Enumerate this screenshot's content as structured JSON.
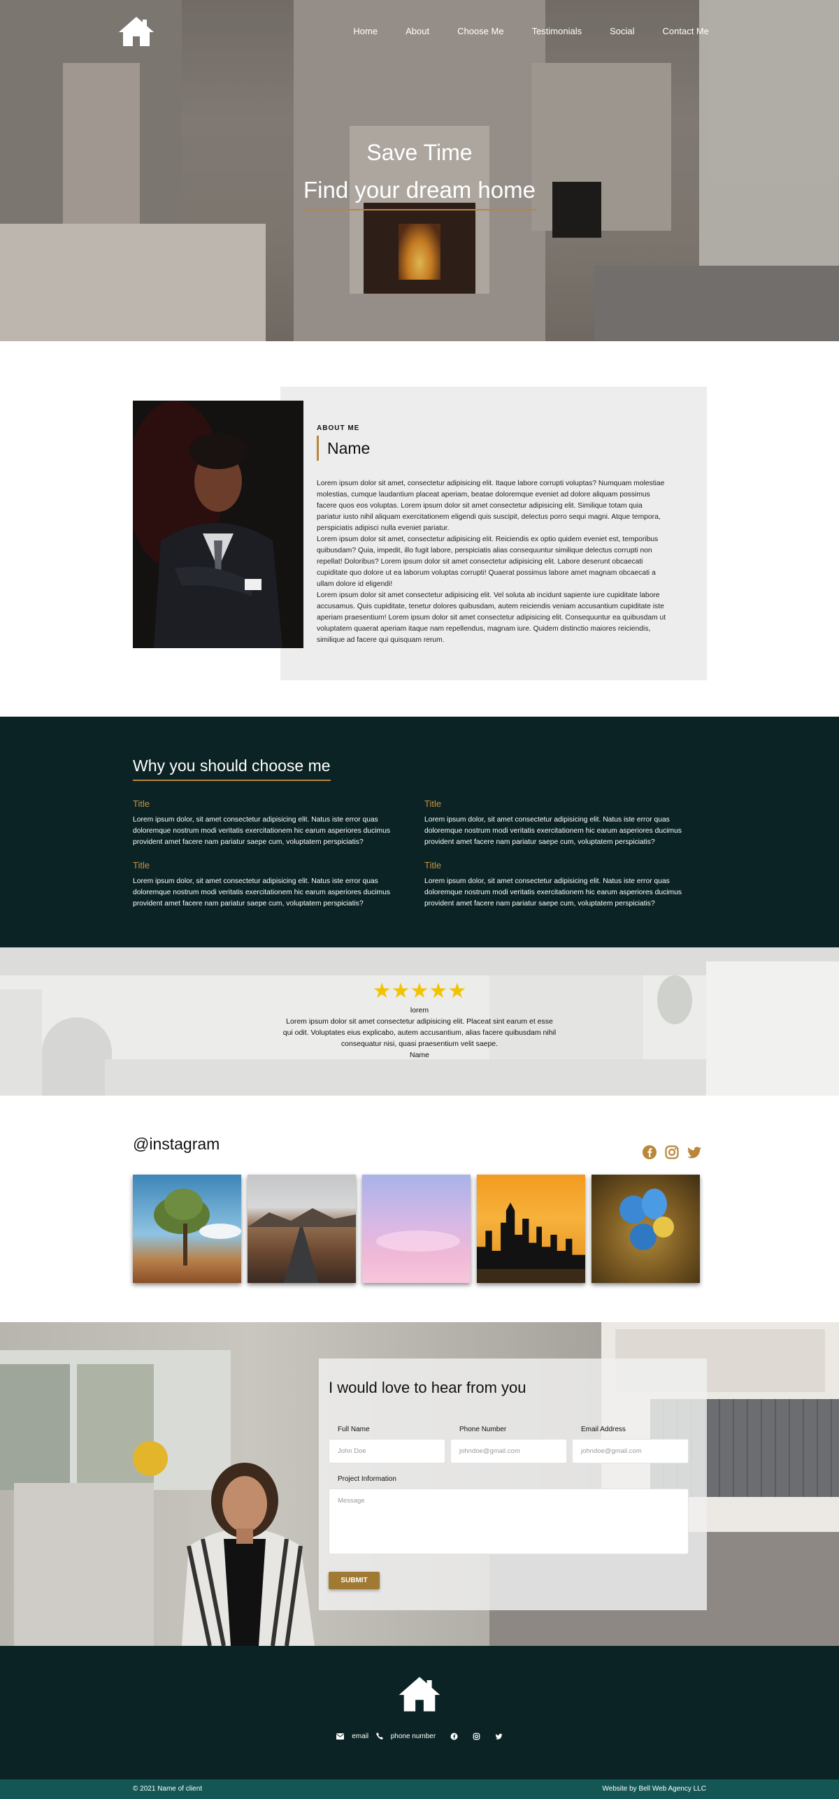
{
  "nav": {
    "items": [
      "Home",
      "About",
      "Choose Me",
      "Testimonials",
      "Social",
      "Contact Me"
    ]
  },
  "hero": {
    "line1": "Save Time",
    "line2": "Find your dream home"
  },
  "about": {
    "eyebrow": "ABOUT ME",
    "name": "Name",
    "paragraphs": [
      "Lorem ipsum dolor sit amet, consectetur adipisicing elit. Itaque labore corrupti voluptas? Numquam molestiae molestias, cumque laudantium placeat aperiam, beatae doloremque eveniet ad dolore aliquam possimus facere quos eos voluptas. Lorem ipsum dolor sit amet consectetur adipisicing elit. Similique totam quia pariatur iusto nihil aliquam exercitationem eligendi quis suscipit, delectus porro sequi magni. Atque tempora, perspiciatis adipisci nulla eveniet pariatur.",
      "Lorem ipsum dolor sit amet, consectetur adipisicing elit. Reiciendis ex optio quidem eveniet est, temporibus quibusdam? Quia, impedit, illo fugit labore, perspiciatis alias consequuntur similique delectus corrupti non repellat! Doloribus? Lorem ipsum dolor sit amet consectetur adipisicing elit. Labore deserunt obcaecati cupiditate quo dolore ut ea laborum voluptas corrupti! Quaerat possimus labore amet magnam obcaecati a ullam dolore id eligendi!",
      "Lorem ipsum dolor sit amet consectetur adipisicing elit. Vel soluta ab incidunt sapiente iure cupiditate labore accusamus. Quis cupiditate, tenetur dolores quibusdam, autem reiciendis veniam accusantium cupiditate iste aperiam praesentium! Lorem ipsum dolor sit amet consectetur adipisicing elit. Consequuntur ea quibusdam ut voluptatem quaerat aperiam itaque nam repellendus, magnam iure. Quidem distinctio maiores reiciendis, similique ad facere qui quisquam rerum."
    ]
  },
  "choose": {
    "heading": "Why you should choose me",
    "items": [
      {
        "title": "Title",
        "text": "Lorem ipsum dolor, sit amet consectetur adipisicing elit. Natus iste error quas doloremque nostrum modi veritatis exercitationem hic earum asperiores ducimus provident amet facere nam pariatur saepe cum, voluptatem perspiciatis?"
      },
      {
        "title": "Title",
        "text": "Lorem ipsum dolor, sit amet consectetur adipisicing elit. Natus iste error quas doloremque nostrum modi veritatis exercitationem hic earum asperiores ducimus provident amet facere nam pariatur saepe cum, voluptatem perspiciatis?"
      },
      {
        "title": "Title",
        "text": "Lorem ipsum dolor, sit amet consectetur adipisicing elit. Natus iste error quas doloremque nostrum modi veritatis exercitationem hic earum asperiores ducimus provident amet facere nam pariatur saepe cum, voluptatem perspiciatis?"
      },
      {
        "title": "Title",
        "text": "Lorem ipsum dolor, sit amet consectetur adipisicing elit. Natus iste error quas doloremque nostrum modi veritatis exercitationem hic earum asperiores ducimus provident amet facere nam pariatur saepe cum, voluptatem perspiciatis?"
      }
    ]
  },
  "testimonial": {
    "stars": "★★★★★",
    "rating": 5,
    "label": "lorem",
    "quote": "Lorem ipsum dolor sit amet consectetur adipisicing elit. Placeat sint earum et esse qui odit. Voluptates eius explicabo, autem accusantium, alias facere quibusdam nihil consequatur nisi, quasi praesentium velit saepe.",
    "author": "Name"
  },
  "instagram": {
    "heading": "@instagram",
    "socials": [
      "facebook-icon",
      "instagram-icon",
      "twitter-icon"
    ],
    "tiles": [
      "tree",
      "road",
      "pink-sky",
      "city-skyline",
      "blue-flower"
    ]
  },
  "contact": {
    "heading": "I would love to hear from you",
    "fields": {
      "full_name": {
        "label": "Full Name",
        "placeholder": "John Doe"
      },
      "phone": {
        "label": "Phone Number",
        "placeholder": "johndoe@gmail.com"
      },
      "email": {
        "label": "Email Address",
        "placeholder": "johndoe@gmail.com"
      },
      "project": {
        "label": "Project Information",
        "placeholder": "Message"
      }
    },
    "submit": "SUBMIT"
  },
  "footer": {
    "email": "email",
    "phone": "phone number",
    "copyright": "© 2021 Name of client",
    "credit": "Website by Bell Web Agency LLC"
  },
  "colors": {
    "accent": "#b8873a",
    "dark": "#0b2324",
    "teal": "#135653",
    "star": "#f2c400"
  }
}
